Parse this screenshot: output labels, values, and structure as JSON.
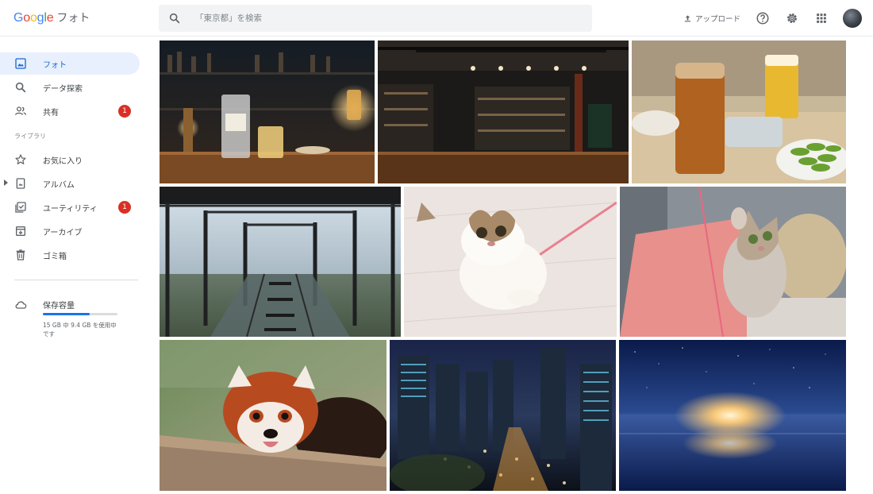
{
  "app": {
    "logo_google": "Google",
    "logo_suffix": "フォト"
  },
  "search": {
    "placeholder": "「東京都」を検索",
    "icon": "search-icon"
  },
  "header": {
    "upload_label": "アップロード",
    "icons": [
      "help-icon",
      "settings-icon",
      "apps-grid-icon",
      "avatar"
    ]
  },
  "sidebar": {
    "items": [
      {
        "label": "フォト",
        "icon": "photo-icon",
        "active": true
      },
      {
        "label": "データ探索",
        "icon": "search-icon"
      },
      {
        "label": "共有",
        "icon": "people-icon",
        "badge": "1"
      },
      {
        "label": "お気に入り",
        "icon": "star-icon"
      },
      {
        "label": "アルバム",
        "icon": "album-icon"
      },
      {
        "label": "ユーティリティ",
        "icon": "utilities-icon",
        "badge": "1"
      },
      {
        "label": "アーカイブ",
        "icon": "archive-icon"
      },
      {
        "label": "ゴミ箱",
        "icon": "trash-icon"
      }
    ],
    "library_label": "ライブラリ",
    "storage": {
      "title": "保存容量",
      "text": "15 GB 中 9.4 GB を使用中です",
      "used_fraction": 0.63
    }
  },
  "photos": [
    {
      "name": "photo-bar-counter-drinks"
    },
    {
      "name": "photo-bar-interior"
    },
    {
      "name": "photo-beer-edamame"
    },
    {
      "name": "photo-observation-deck"
    },
    {
      "name": "photo-cat-white-floor"
    },
    {
      "name": "photo-cat-pink-mat"
    },
    {
      "name": "photo-red-panda"
    },
    {
      "name": "photo-city-night"
    },
    {
      "name": "photo-starry-sky-reflection"
    }
  ],
  "colors": {
    "accent": "#1a73e8",
    "active_bg": "#e8f0fe",
    "badge": "#d93025"
  }
}
